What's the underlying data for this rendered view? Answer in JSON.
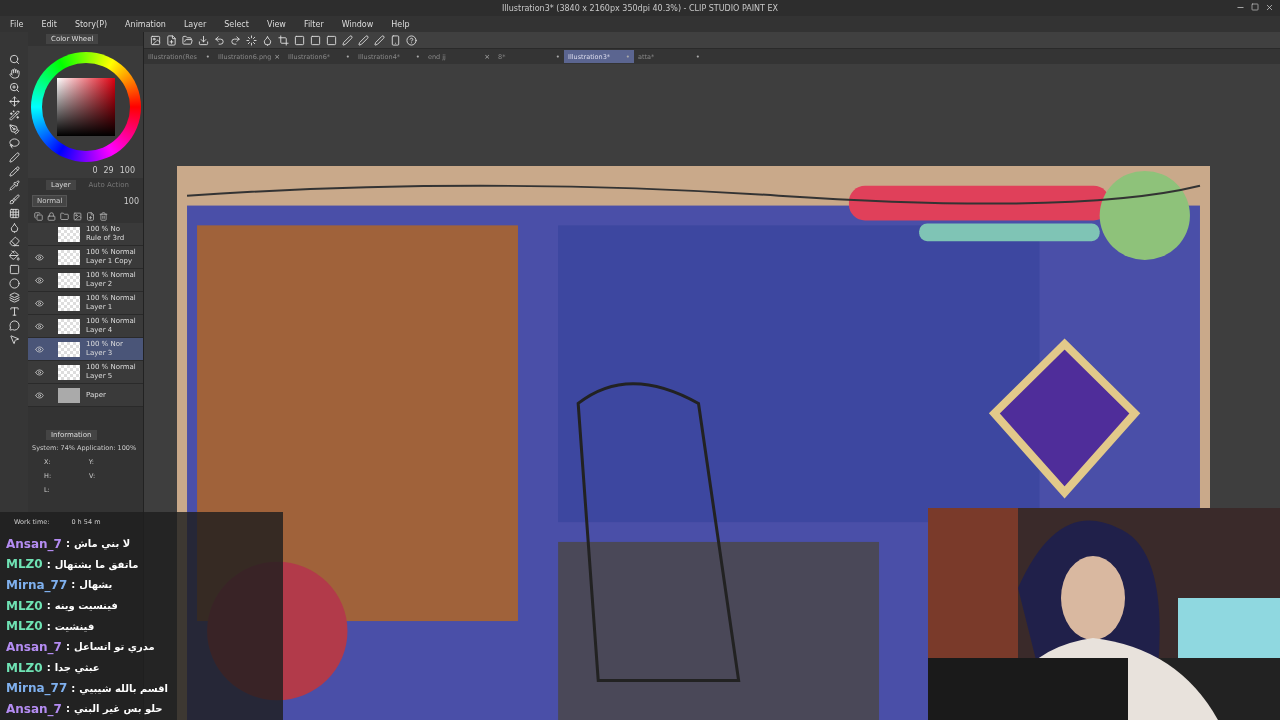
{
  "window": {
    "title": "Illustration3* (3840 x 2160px 350dpi 40.3%) - CLIP STUDIO PAINT EX"
  },
  "menu": [
    "File",
    "Edit",
    "Story(P)",
    "Animation",
    "Layer",
    "Select",
    "View",
    "Filter",
    "Window",
    "Help"
  ],
  "document_tabs": [
    {
      "label": "Illustration(Res",
      "close": "•",
      "selected": false
    },
    {
      "label": "Illustration6.png",
      "close": "×",
      "selected": false
    },
    {
      "label": "Illustration6*",
      "close": "•",
      "selected": false
    },
    {
      "label": "Illustration4*",
      "close": "•",
      "selected": false
    },
    {
      "label": "end jj",
      "close": "×",
      "selected": false
    },
    {
      "label": "8*",
      "close": "•",
      "selected": false
    },
    {
      "label": "Illustration3*",
      "close": "•",
      "selected": true
    },
    {
      "label": "atta*",
      "close": "•",
      "selected": false
    }
  ],
  "color_panel": {
    "tab": "Color Wheel",
    "hue_value": "0",
    "saturation_value": "29",
    "brightness_value": "100"
  },
  "layer_panel": {
    "tabs": [
      {
        "label": "Layer",
        "selected": true
      },
      {
        "label": "Auto Action",
        "selected": false
      }
    ],
    "blend_mode": "Normal",
    "opacity": "100",
    "layers": [
      {
        "mode": "100 % No",
        "name": "Rule of 3rd",
        "visible": false,
        "selected": false,
        "kind": "folder"
      },
      {
        "mode": "100 % Normal",
        "name": "Layer 1 Copy",
        "visible": true,
        "selected": false,
        "kind": "raster"
      },
      {
        "mode": "100 % Normal",
        "name": "Layer 2",
        "visible": true,
        "selected": false,
        "kind": "raster"
      },
      {
        "mode": "100 % Normal",
        "name": "Layer 1",
        "visible": true,
        "selected": false,
        "kind": "raster"
      },
      {
        "mode": "100 % Normal",
        "name": "Layer 4",
        "visible": true,
        "selected": false,
        "kind": "raster"
      },
      {
        "mode": "100 % Nor",
        "name": "Layer 3",
        "visible": true,
        "selected": true,
        "kind": "raster"
      },
      {
        "mode": "100 % Normal",
        "name": "Layer 5",
        "visible": true,
        "selected": false,
        "kind": "raster"
      },
      {
        "name": "Paper",
        "visible": true,
        "selected": false,
        "kind": "paper"
      }
    ]
  },
  "info_panel": {
    "tab": "Information",
    "usage": "System: 74%  Application: 100%",
    "coords": [
      "X:",
      "Y:",
      "H:",
      "V:",
      "L:"
    ],
    "work_time_label": "Work time:",
    "work_time": "0 h 54 m"
  },
  "chat": [
    {
      "user": "Ansan_7",
      "separator": ":",
      "message": "لا بني ماش",
      "color": "#b48cf2"
    },
    {
      "user": "MLZ0",
      "separator": ":",
      "message": "ماتفق ما يشتهال",
      "color": "#6fe3b4"
    },
    {
      "user": "Mirna_77",
      "separator": ":",
      "message": "يشهال",
      "color": "#7fb0ee"
    },
    {
      "user": "MLZ0",
      "separator": ":",
      "message": "فينسيت وينه",
      "color": "#6fe3b4"
    },
    {
      "user": "MLZ0",
      "separator": ":",
      "message": "فينشيت",
      "color": "#6fe3b4"
    },
    {
      "user": "Ansan_7",
      "separator": ":",
      "message": "مدري تو اتساعل",
      "color": "#b48cf2"
    },
    {
      "user": "MLZ0",
      "separator": ":",
      "message": "عبثي جدا",
      "color": "#6fe3b4"
    },
    {
      "user": "Mirna_77",
      "separator": ":",
      "message": "اقسم بالله شيبيي",
      "color": "#7fb0ee"
    },
    {
      "user": "Ansan_7",
      "separator": ":",
      "message": "حلو بس غير البني",
      "color": "#b48cf2"
    }
  ]
}
